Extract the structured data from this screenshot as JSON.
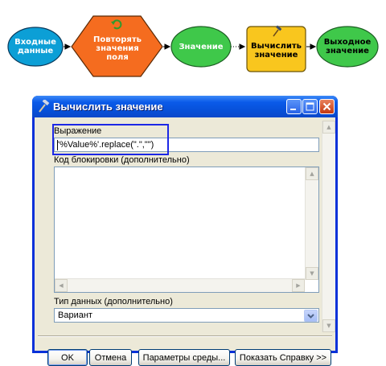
{
  "model": {
    "nodes": [
      {
        "label": "Входные\nданные",
        "color": "#0c9fd6"
      },
      {
        "label": "Повторять\nзначения\nполя",
        "color": "#f56c1f"
      },
      {
        "label": "Значение",
        "color": "#3fc84a"
      },
      {
        "label": "Вычислить\nзначение",
        "color": "#f9c61e"
      },
      {
        "label": "Выходное\nзначение",
        "color": "#3fc84a"
      }
    ]
  },
  "dialog": {
    "title": "Вычислить значение",
    "expression": {
      "label": "Выражение",
      "value": "'%Value%'.replace(\".\",\"\")"
    },
    "code_block": {
      "label": "Код блокировки (дополнительно)",
      "value": ""
    },
    "data_type": {
      "label": "Тип данных (дополнительно)",
      "selected": "Вариант"
    },
    "buttons": {
      "ok": "OK",
      "cancel": "Отмена",
      "environment": "Параметры среды...",
      "help": "Показать Справку >>"
    }
  },
  "colors": {
    "title_bar": "#0a5ae9",
    "highlight_box": "#1c27e6",
    "dialog_face": "#ece9d8"
  }
}
